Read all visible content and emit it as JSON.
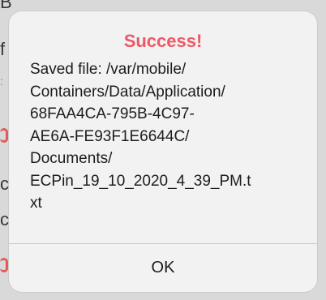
{
  "alert": {
    "title": "Success!",
    "message": "Saved file: /var/mobile/\nContainers/Data/Application/\n68FAA4CA-795B-4C97-\nAE6A-FE93F1E6644C/\nDocuments/\nECPin_19_10_2020_4_39_PM.t\nxt",
    "ok_label": "OK"
  },
  "colors": {
    "title": "#ee5866",
    "alert_background": "#f2f2f2",
    "backdrop": "#d9d9d9"
  }
}
